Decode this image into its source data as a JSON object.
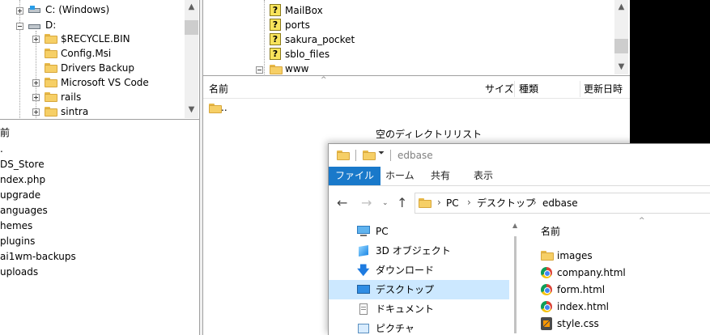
{
  "local_tree": {
    "items": [
      {
        "label": "C: (Windows)",
        "icon": "drive-icon"
      },
      {
        "label": "D:",
        "icon": "drive-icon"
      },
      {
        "label": "$RECYCLE.BIN",
        "icon": "folder-icon"
      },
      {
        "label": "Config.Msi",
        "icon": "folder-icon"
      },
      {
        "label": "Drivers Backup",
        "icon": "folder-icon"
      },
      {
        "label": "Microsoft VS Code",
        "icon": "folder-icon"
      },
      {
        "label": "rails",
        "icon": "folder-icon"
      },
      {
        "label": "sintra",
        "icon": "folder-icon"
      }
    ]
  },
  "remote_tree": {
    "items": [
      {
        "label": "MailBox",
        "icon": "question-icon"
      },
      {
        "label": "ports",
        "icon": "question-icon"
      },
      {
        "label": "sakura_pocket",
        "icon": "question-icon"
      },
      {
        "label": "sblo_files",
        "icon": "question-icon"
      },
      {
        "label": "www",
        "icon": "folder-icon"
      }
    ]
  },
  "local_files": {
    "header_name": "前",
    "items": [
      ".",
      "DS_Store",
      "ndex.php",
      "upgrade",
      "anguages",
      "hemes",
      "plugins",
      "ai1wm-backups",
      "uploads"
    ]
  },
  "remote_files": {
    "columns": {
      "name": "名前",
      "size": "サイズ",
      "type": "種類",
      "modified": "更新日時"
    },
    "items": [
      ".."
    ],
    "empty_message": "空のディレクトリリスト"
  },
  "explorer": {
    "title": "edbase",
    "ribbon_tabs": [
      "ファイル",
      "ホーム",
      "共有",
      "表示"
    ],
    "address": {
      "segments": [
        "PC",
        "デスクトップ",
        "edbase"
      ]
    },
    "column_name": "名前",
    "nav_items": [
      {
        "label": "PC",
        "icon": "pc-icon"
      },
      {
        "label": "3D オブジェクト",
        "icon": "3d-objects-icon"
      },
      {
        "label": "ダウンロード",
        "icon": "download-icon"
      },
      {
        "label": "デスクトップ",
        "icon": "desktop-icon",
        "selected": true
      },
      {
        "label": "ドキュメント",
        "icon": "document-icon"
      },
      {
        "label": "ピクチャ",
        "icon": "pictures-icon"
      }
    ],
    "files": [
      {
        "label": "images",
        "icon": "folder-icon"
      },
      {
        "label": "company.html",
        "icon": "chrome-icon"
      },
      {
        "label": "form.html",
        "icon": "chrome-icon"
      },
      {
        "label": "index.html",
        "icon": "chrome-icon"
      },
      {
        "label": "style.css",
        "icon": "sublime-icon"
      }
    ]
  }
}
